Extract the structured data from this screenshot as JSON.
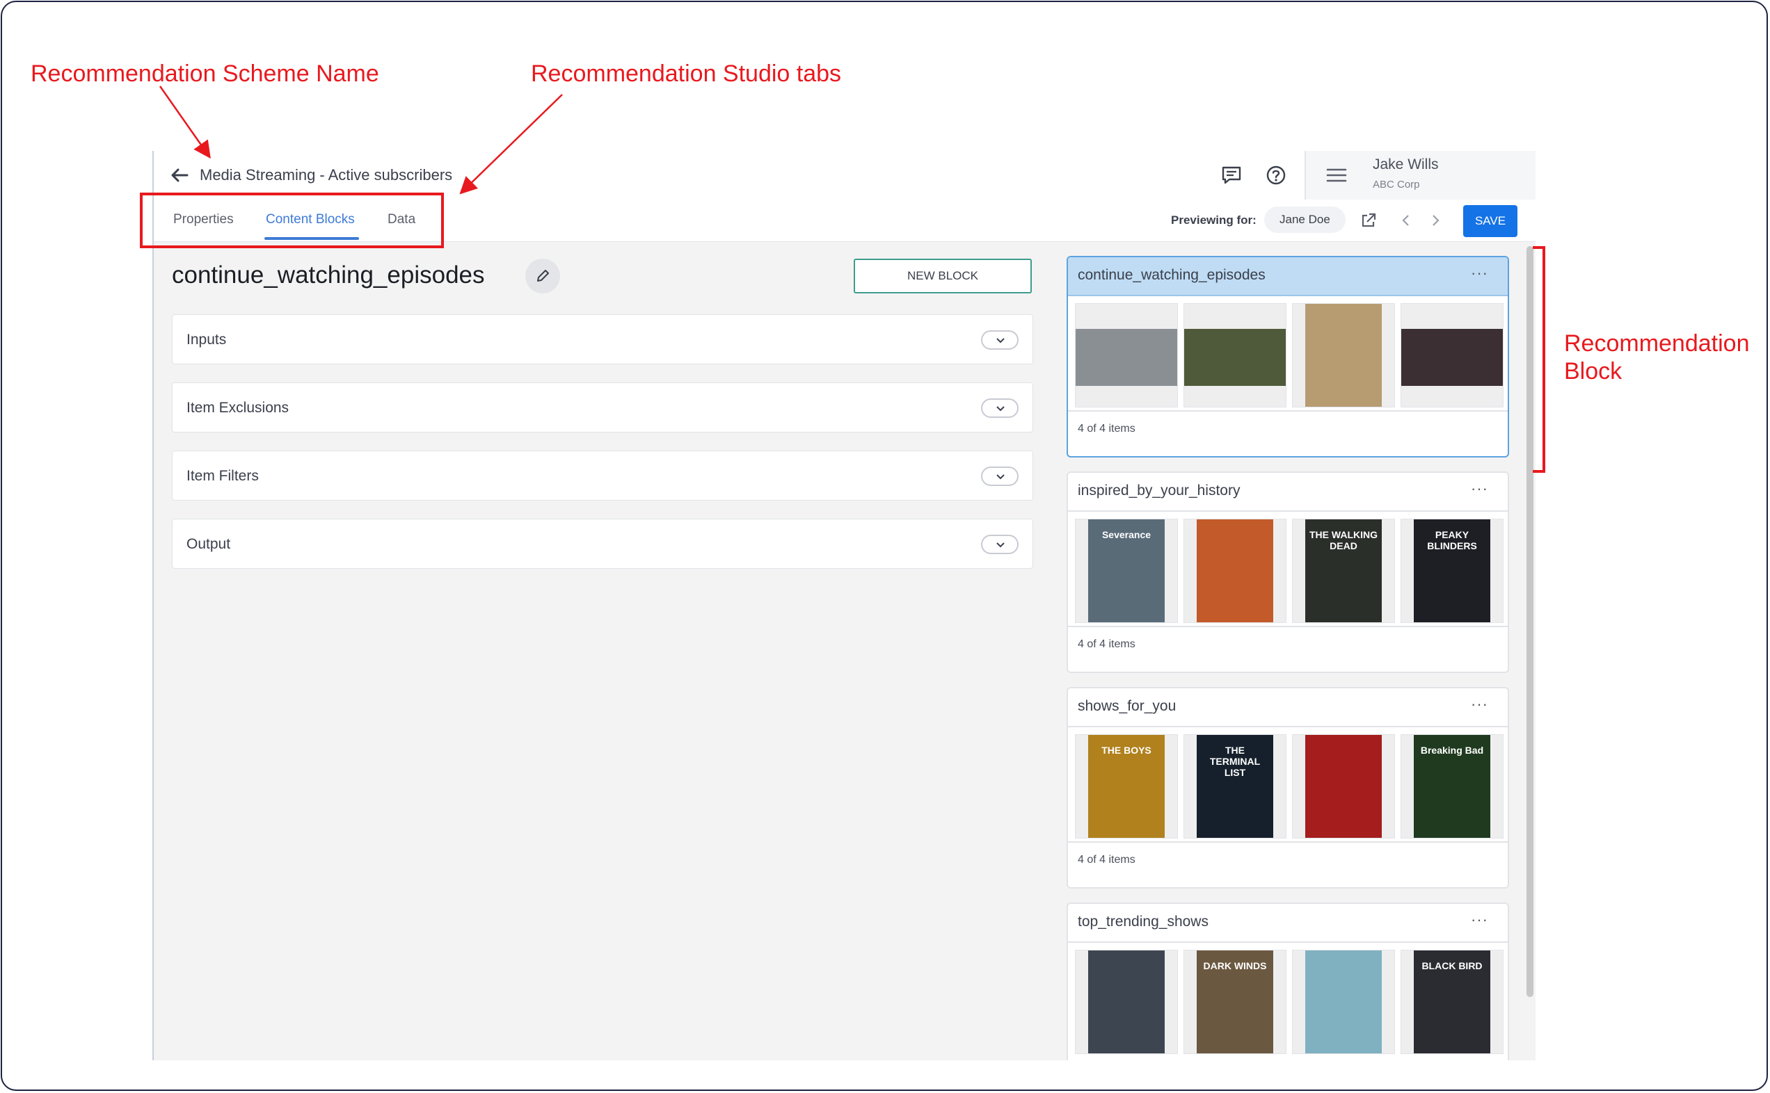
{
  "annotations": {
    "scheme_name": "Recommendation Scheme Name",
    "studio_tabs": "Recommendation Studio tabs",
    "block_line1": "Recommendation",
    "block_line2": "Block"
  },
  "colors": {
    "annotation": "#e8191e",
    "accent": "#3e7bd6",
    "save": "#1473e6",
    "selected_header": "#bfdcf4"
  },
  "header": {
    "scheme_name": "Media Streaming - Active subscribers",
    "icons": [
      "back-arrow-icon",
      "chat-icon",
      "help-icon",
      "hamburger-menu-icon"
    ],
    "user": {
      "name": "Jake Wills",
      "org": "ABC Corp"
    }
  },
  "tabs": [
    {
      "label": "Properties",
      "active": false
    },
    {
      "label": "Content Blocks",
      "active": true
    },
    {
      "label": "Data",
      "active": false
    }
  ],
  "preview": {
    "label": "Previewing for:",
    "user": "Jane Doe",
    "icons": [
      "external-link-icon",
      "chevron-left-icon",
      "chevron-right-icon"
    ]
  },
  "save_label": "SAVE",
  "editor": {
    "block_name": "continue_watching_episodes",
    "new_block_label": "NEW BLOCK",
    "sections": [
      "Inputs",
      "Item Exclusions",
      "Item Filters",
      "Output"
    ]
  },
  "preview_cards": [
    {
      "name": "continue_watching_episodes",
      "count": "4 of 4 items",
      "selected": true,
      "thumbnails": [
        {
          "color": "#8a8f94"
        },
        {
          "color": "#4f5a3a"
        },
        {
          "color": "#b79c72"
        },
        {
          "color": "#3b2f33"
        }
      ]
    },
    {
      "name": "inspired_by_your_history",
      "count": "4 of 4 items",
      "selected": false,
      "thumbnails": [
        {
          "color": "#5a6b78",
          "text": "Severance"
        },
        {
          "color": "#c35a2a"
        },
        {
          "color": "#2b2f2a",
          "text": "THE WALKING DEAD"
        },
        {
          "color": "#1d1f24",
          "text": "PEAKY BLINDERS"
        }
      ]
    },
    {
      "name": "shows_for_you",
      "count": "4 of 4 items",
      "selected": false,
      "thumbnails": [
        {
          "color": "#b0811d",
          "text": "THE BOYS"
        },
        {
          "color": "#15202c",
          "text": "THE TERMINAL LIST"
        },
        {
          "color": "#a51d1d"
        },
        {
          "color": "#1f3a1f",
          "text": "Breaking Bad"
        }
      ]
    },
    {
      "name": "top_trending_shows",
      "count": "",
      "selected": false,
      "thumbnails": [
        {
          "color": "#3c4550"
        },
        {
          "color": "#6b5840",
          "text": "DARK WINDS"
        },
        {
          "color": "#7fb1c1"
        },
        {
          "color": "#2a2c31",
          "text": "BLACK BIRD"
        }
      ]
    }
  ]
}
